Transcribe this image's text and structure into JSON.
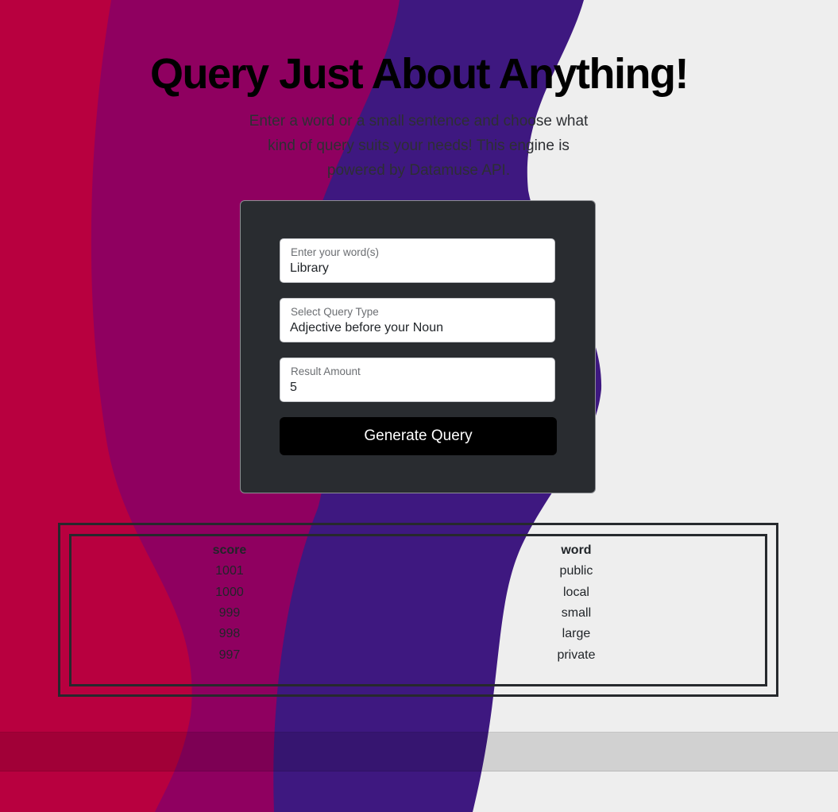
{
  "header": {
    "title": "Query Just About Anything!",
    "description": "Enter a word or a small sentence and choose what kind of query suits your needs! This engine is powered by Datamuse API."
  },
  "form": {
    "words": {
      "label": "Enter your word(s)",
      "value": "Library"
    },
    "query_type": {
      "label": "Select Query Type",
      "value": "Adjective before your Noun"
    },
    "result_amount": {
      "label": "Result Amount",
      "value": "5"
    },
    "submit_label": "Generate Query"
  },
  "results": {
    "headers": {
      "score": "score",
      "word": "word"
    },
    "rows": [
      {
        "score": "1001",
        "word": "public"
      },
      {
        "score": "1000",
        "word": "local"
      },
      {
        "score": "999",
        "word": "small"
      },
      {
        "score": "998",
        "word": "large"
      },
      {
        "score": "997",
        "word": "private"
      }
    ]
  },
  "colors": {
    "background": "#eeeeee",
    "wave_red": "#b8003f",
    "wave_magenta": "#8f0060",
    "wave_indigo": "#3e1880",
    "card": "#292c30",
    "button": "#000000"
  }
}
